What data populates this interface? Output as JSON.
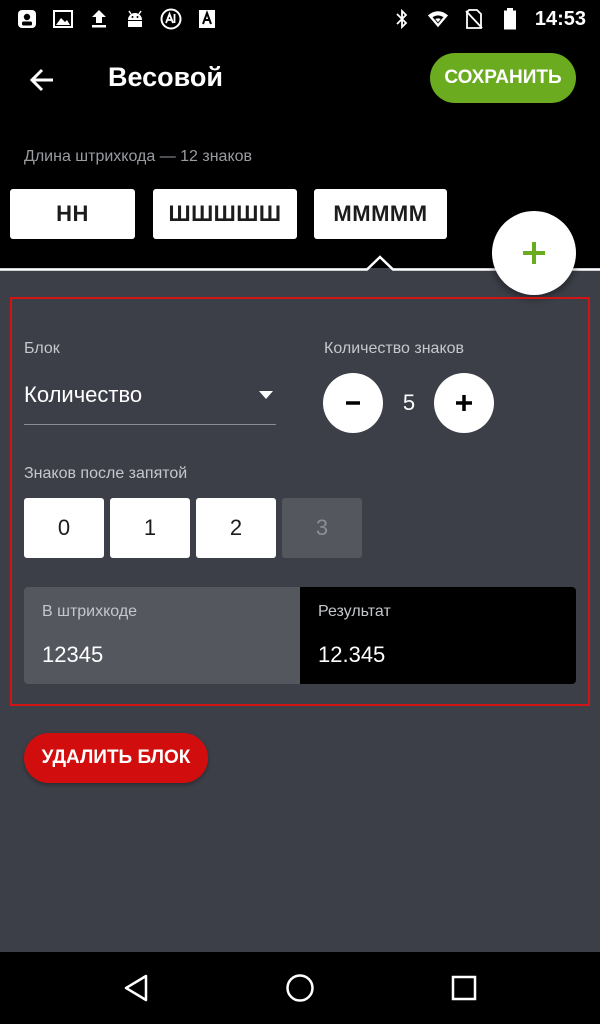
{
  "status_bar": {
    "time": "14:53",
    "left_icons": [
      "account-badge-icon",
      "image-icon",
      "upload-icon",
      "android-icon",
      "ai-circle-icon",
      "font-a-icon"
    ],
    "right_icons": [
      "bluetooth-icon",
      "wifi-icon",
      "no-sim-icon",
      "battery-icon"
    ]
  },
  "header": {
    "title": "Весовой",
    "save_label": "СОХРАНИТЬ",
    "barcode_length": "Длина штрихкода — 12 знаков",
    "chips": [
      "НН",
      "ШШШШШ",
      "ММММM"
    ],
    "selected_chip_index": 2,
    "add_icon": "plus-icon"
  },
  "block": {
    "label": "Блок",
    "selected": "Количество",
    "count_label": "Количество знаков",
    "count_value": "5",
    "decimals_label": "Знаков после запятой",
    "decimals": [
      "0",
      "1",
      "2",
      "3"
    ],
    "disabled_decimal_index": 3,
    "in_barcode_label": "В штрихкоде",
    "in_barcode_value": "12345",
    "result_label": "Результат",
    "result_value": "12.345"
  },
  "delete_label": "УДАЛИТЬ БЛОК",
  "colors": {
    "accent_green": "#6aab1f",
    "danger_red": "#d20d0d",
    "background": "#3d3f48",
    "highlight_border": "#d21414"
  },
  "nav_bar": [
    "back-icon",
    "home-icon",
    "recents-icon"
  ]
}
